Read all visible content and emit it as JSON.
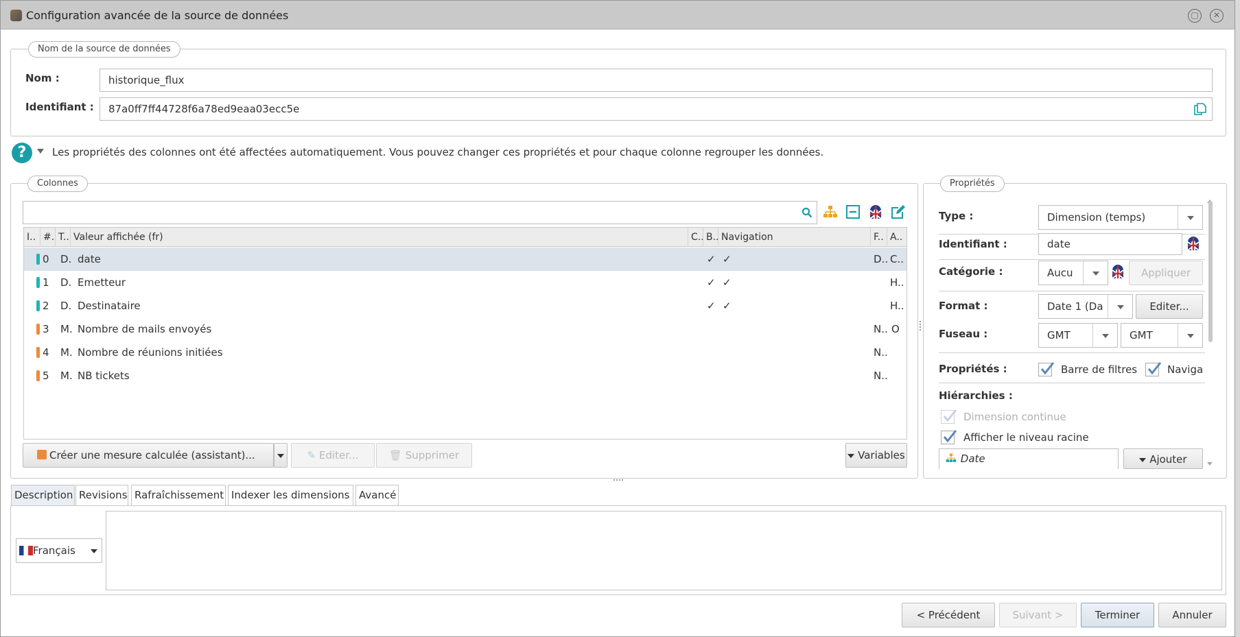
{
  "window": {
    "title": "Configuration avancée de la source de données"
  },
  "name_section": {
    "legend": "Nom de la source de données",
    "nom_label": "Nom :",
    "nom_value": "historique_flux",
    "id_label": "Identifiant :",
    "id_value": "87a0ff7ff44728f6a78ed9eaa03ecc5e"
  },
  "info": {
    "text": "Les propriétés des colonnes ont été affectées automatiquement. Vous pouvez changer ces propriétés et pour chaque colonne regrouper les données."
  },
  "columns": {
    "legend": "Colonnes",
    "headers": [
      "I..",
      "#..",
      "T..",
      "Valeur affichée (fr)",
      "C..",
      "B..",
      "Navigation",
      "F..",
      "A.."
    ],
    "rows": [
      {
        "index": "0",
        "type": "D.",
        "value": "date",
        "c": "",
        "b": "✓",
        "nav": "✓",
        "f": "D..",
        "a": "C..",
        "marker": "#1fb5b5"
      },
      {
        "index": "1",
        "type": "D.",
        "value": "Emetteur",
        "c": "",
        "b": "✓",
        "nav": "✓",
        "f": "",
        "a": "H..",
        "marker": "#1fb5b5"
      },
      {
        "index": "2",
        "type": "D.",
        "value": "Destinataire",
        "c": "",
        "b": "✓",
        "nav": "✓",
        "f": "",
        "a": "H..",
        "marker": "#1fb5b5"
      },
      {
        "index": "3",
        "type": "M.",
        "value": "Nombre de mails envoyés",
        "c": "",
        "b": "",
        "nav": "",
        "f": "N..",
        "a": "O",
        "marker": "#f0883a"
      },
      {
        "index": "4",
        "type": "M.",
        "value": "Nombre de réunions initiées",
        "c": "",
        "b": "",
        "nav": "",
        "f": "N..",
        "a": "",
        "marker": "#f0883a"
      },
      {
        "index": "5",
        "type": "M.",
        "value": "NB tickets",
        "c": "",
        "b": "",
        "nav": "",
        "f": "N..",
        "a": "",
        "marker": "#f0883a"
      }
    ],
    "create_btn": "Créer une mesure calculée (assistant)...",
    "edit_btn": "Editer...",
    "delete_btn": "Supprimer",
    "variables_btn": "Variables"
  },
  "properties": {
    "legend": "Propriétés",
    "type_label": "Type :",
    "type_value": "Dimension (temps)",
    "id_label": "Identifiant :",
    "id_value": "date",
    "cat_label": "Catégorie :",
    "cat_value": "Aucu",
    "apply_btn": "Appliquer",
    "format_label": "Format :",
    "format_value": "Date 1 (Da",
    "format_edit_btn": "Editer...",
    "tz_label": "Fuseau :",
    "tz_value1": "GMT",
    "tz_value2": "GMT",
    "props_label": "Propriétés :",
    "filter_bar": "Barre de filtres",
    "navigation": "Naviga",
    "hier_label": "Hiérarchies :",
    "continuous": "Dimension continue",
    "root_level": "Afficher le niveau racine",
    "hier_item": "Date",
    "add_btn": "Ajouter"
  },
  "tabs": [
    "Description",
    "Revisions",
    "Rafraîchissement",
    "Indexer les dimensions",
    "Avancé"
  ],
  "description": {
    "language": "Français"
  },
  "footer": {
    "prev": "< Précédent",
    "next": "Suivant >",
    "finish": "Terminer",
    "cancel": "Annuler"
  }
}
